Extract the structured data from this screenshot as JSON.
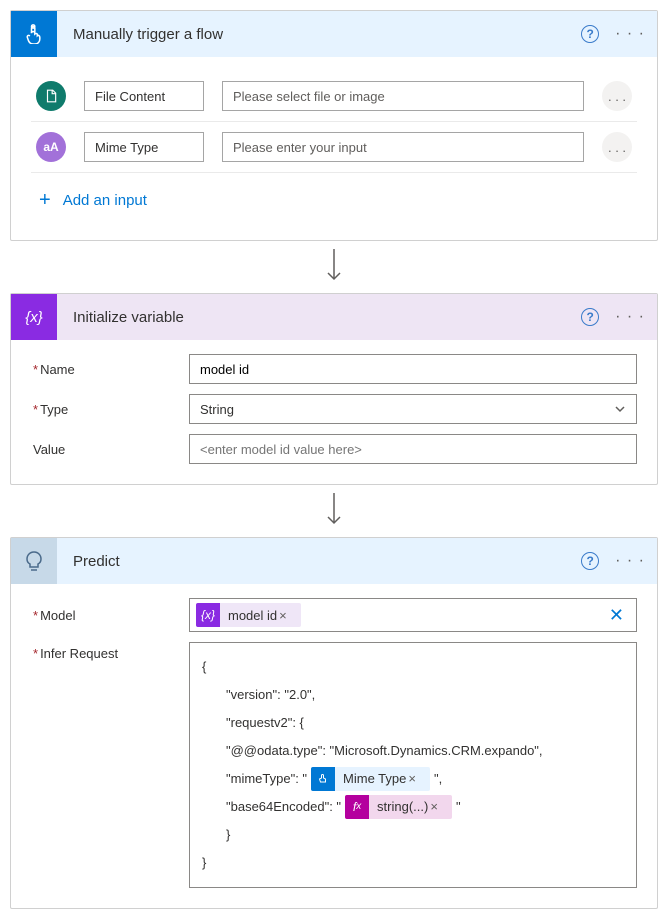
{
  "trigger": {
    "title": "Manually trigger a flow",
    "fileContent": {
      "label": "File Content",
      "placeholder": "Please select file or image"
    },
    "mimeType": {
      "label": "Mime Type",
      "placeholder": "Please enter your input"
    },
    "addInput": "Add an input"
  },
  "initVar": {
    "title": "Initialize variable",
    "nameLabel": "Name",
    "nameValue": "model id",
    "typeLabel": "Type",
    "typeValue": "String",
    "valueLabel": "Value",
    "valuePlaceholder": "<enter model id value here>"
  },
  "predict": {
    "title": "Predict",
    "modelLabel": "Model",
    "modelToken": "model id",
    "inferLabel": "Infer Request",
    "json": {
      "open": "{",
      "version": "\"version\": \"2.0\",",
      "requestv2": "\"requestv2\": {",
      "odata": "\"@@odata.type\": \"Microsoft.Dynamics.CRM.expando\",",
      "mimeLabel": "\"mimeType\": \"",
      "mimeToken": "Mime Type",
      "b64Label": "\"base64Encoded\": \"",
      "b64Token": "string(...)",
      "close1": "}",
      "close2": "}"
    }
  }
}
